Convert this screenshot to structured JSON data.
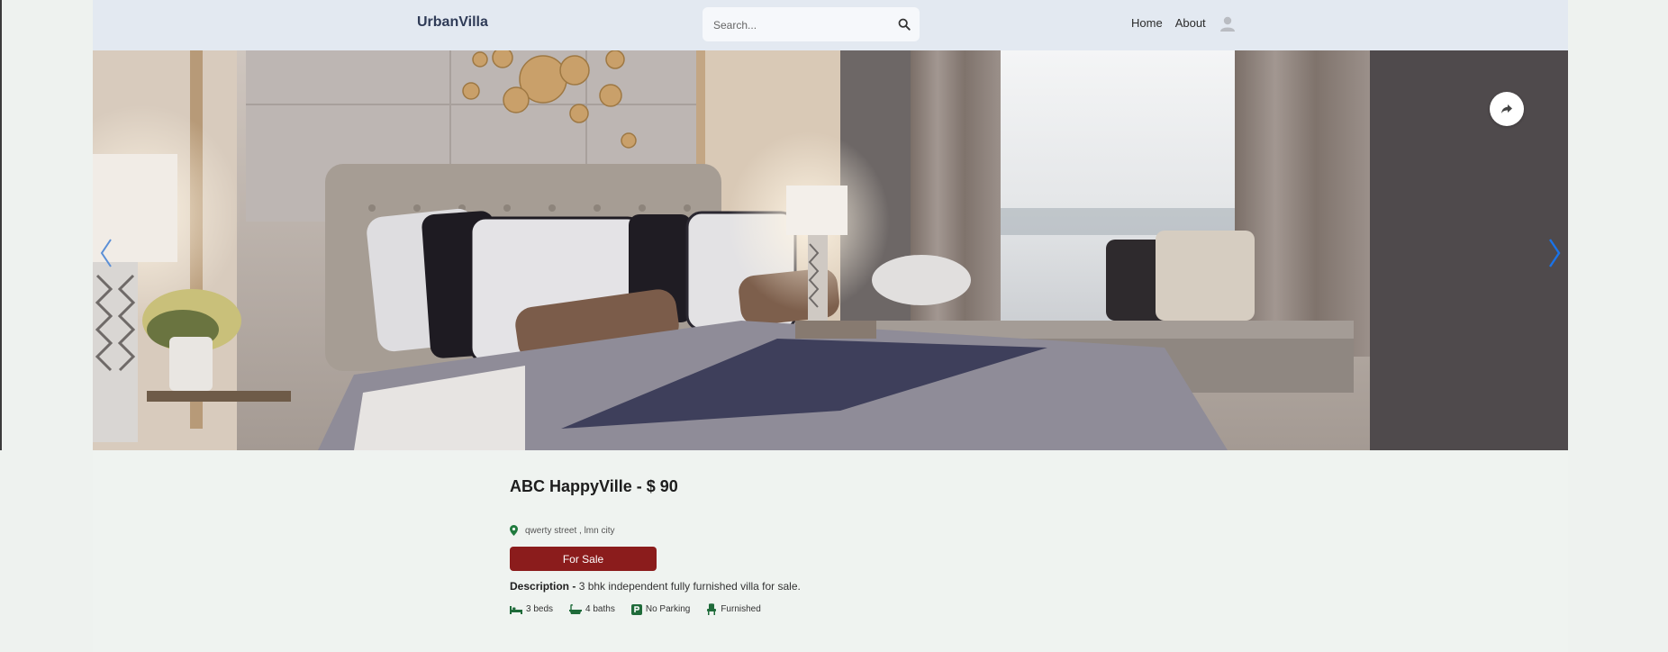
{
  "navbar": {
    "brand_prefix": "Urban",
    "brand_suffix": "Villa",
    "search_placeholder": "Search...",
    "links": [
      "Home",
      "About"
    ]
  },
  "hero": {
    "prev_icon": "chevron-left-icon",
    "next_icon": "chevron-right-icon",
    "share_icon": "share-icon"
  },
  "listing": {
    "name": "ABC HappyVille",
    "separator": " - ",
    "price": "$ 90",
    "location": "qwerty street , lmn city",
    "status": "For Sale",
    "description_label": "Description - ",
    "description": "3 bhk independent fully furnished villa for sale.",
    "amenities": [
      {
        "icon": "bed-icon",
        "label": "3 beds"
      },
      {
        "icon": "bath-icon",
        "label": "4 baths"
      },
      {
        "icon": "parking-icon",
        "label": "No Parking"
      },
      {
        "icon": "chair-icon",
        "label": "Furnished"
      }
    ]
  },
  "colors": {
    "navbar_bg": "#e3e9f1",
    "status_badge": "#8b1c1c",
    "chevron": "#1a73e8"
  }
}
